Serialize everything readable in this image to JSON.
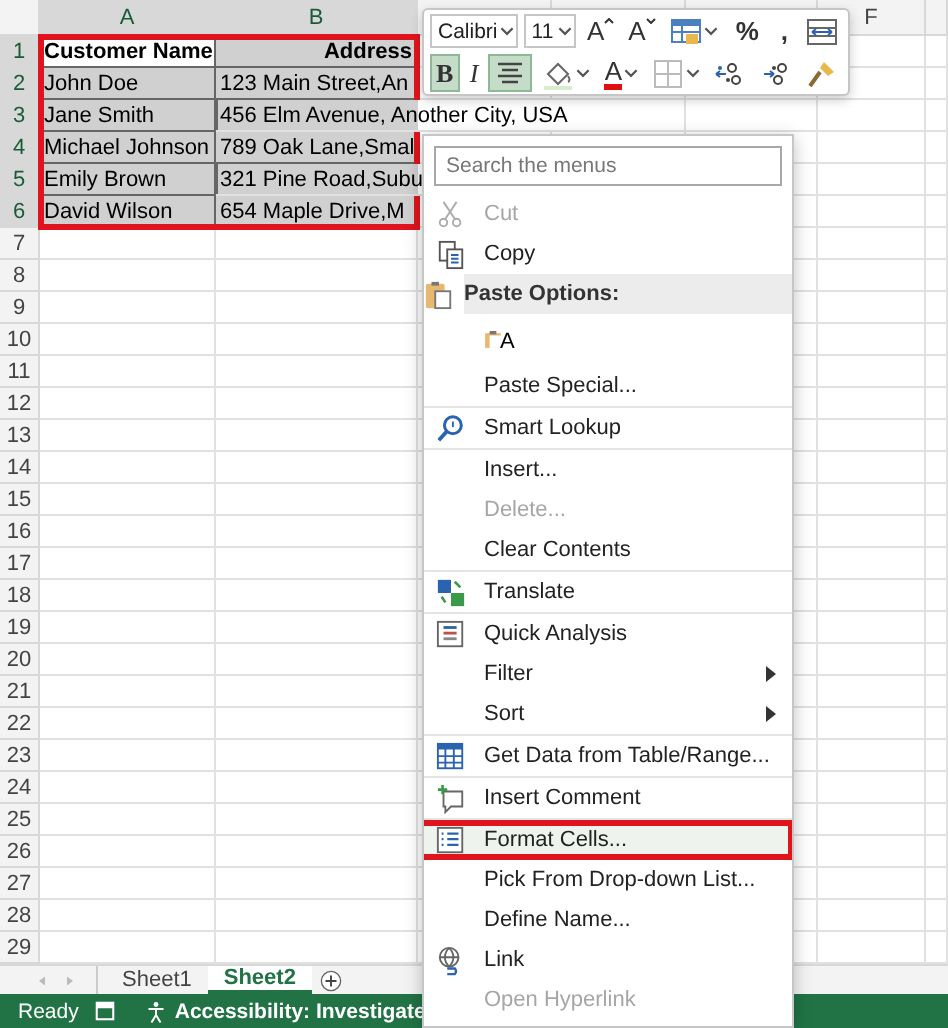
{
  "sheet": {
    "columns": [
      {
        "label": "A",
        "selected": true
      },
      {
        "label": "B",
        "selected": true
      },
      {
        "selected": false
      },
      {
        "selected": false
      },
      {
        "selected": false
      },
      {
        "label": "F",
        "selected": false
      }
    ],
    "row_numbers": [
      {
        "label": "1",
        "selected": true
      },
      {
        "label": "2",
        "selected": true
      },
      {
        "label": "3",
        "selected": true
      },
      {
        "label": "4",
        "selected": true
      },
      {
        "label": "5",
        "selected": true
      },
      {
        "label": "6",
        "selected": true
      },
      {
        "label": "7",
        "selected": false
      },
      {
        "label": "8",
        "selected": false
      },
      {
        "label": "9",
        "selected": false
      },
      {
        "label": "10",
        "selected": false
      },
      {
        "label": "11",
        "selected": false
      },
      {
        "label": "12",
        "selected": false
      },
      {
        "label": "13",
        "selected": false
      },
      {
        "label": "14",
        "selected": false
      },
      {
        "label": "15",
        "selected": false
      },
      {
        "label": "16",
        "selected": false
      },
      {
        "label": "17",
        "selected": false
      },
      {
        "label": "18",
        "selected": false
      },
      {
        "label": "19",
        "selected": false
      },
      {
        "label": "20",
        "selected": false
      },
      {
        "label": "21",
        "selected": false
      },
      {
        "label": "22",
        "selected": false
      },
      {
        "label": "23",
        "selected": false
      },
      {
        "label": "24",
        "selected": false
      },
      {
        "label": "25",
        "selected": false
      },
      {
        "label": "26",
        "selected": false
      },
      {
        "label": "27",
        "selected": false
      },
      {
        "label": "28",
        "selected": false
      },
      {
        "label": "29",
        "selected": false
      }
    ],
    "header": [
      {
        "text": "Customer Name",
        "selected": false
      },
      {
        "text": "Address",
        "selected": true
      }
    ],
    "rows": [
      [
        {
          "text": "John Doe",
          "selected": true
        },
        {
          "text": "123 Main Street,An",
          "selected": true
        }
      ],
      [
        {
          "text": "Jane Smith",
          "selected": true
        },
        {
          "text": "456 Elm Avenue, Another City, USA",
          "selected": true
        }
      ],
      [
        {
          "text": "Michael Johnson",
          "selected": true
        },
        {
          "text": "789 Oak Lane,Smal",
          "selected": true
        }
      ],
      [
        {
          "text": "Emily Brown",
          "selected": true
        },
        {
          "text": "321 Pine Road,Subu",
          "selected": true
        }
      ],
      [
        {
          "text": "David Wilson",
          "selected": true
        },
        {
          "text": "654 Maple Drive,M",
          "selected": true
        }
      ]
    ],
    "range_outlined": true
  },
  "mini_toolbar": {
    "font": "Calibri",
    "size": "11",
    "grow_font": "A",
    "shrink_font": "A",
    "percent": "%",
    "comma": ",",
    "bold": {
      "label": "B",
      "selected": true
    },
    "italic": {
      "label": "I",
      "selected": false
    },
    "center_align": {
      "selected": true
    },
    "font_color": "A"
  },
  "context_menu": {
    "search": {
      "placeholder": "Search the menus"
    },
    "groups": [
      [
        {
          "kind": "command",
          "label": "Cut",
          "disabled": true,
          "submenu": false,
          "outlined": false
        },
        {
          "kind": "command",
          "label": "Copy",
          "disabled": false,
          "submenu": false,
          "outlined": false
        },
        {
          "kind": "header",
          "label": "Paste Options:"
        },
        {
          "kind": "paste_option",
          "label": "A"
        },
        {
          "kind": "command",
          "label": "Paste Special...",
          "disabled": false,
          "submenu": false,
          "outlined": false
        }
      ],
      [
        {
          "kind": "command",
          "label": "Smart Lookup",
          "disabled": false,
          "submenu": false,
          "outlined": false
        }
      ],
      [
        {
          "kind": "command",
          "label": "Insert...",
          "disabled": false,
          "submenu": false,
          "outlined": false
        },
        {
          "kind": "command",
          "label": "Delete...",
          "disabled": true,
          "submenu": false,
          "outlined": false
        },
        {
          "kind": "command",
          "label": "Clear Contents",
          "disabled": false,
          "submenu": false,
          "outlined": false
        }
      ],
      [
        {
          "kind": "command",
          "label": "Translate",
          "disabled": false,
          "submenu": false,
          "outlined": false
        }
      ],
      [
        {
          "kind": "command",
          "label": "Quick Analysis",
          "disabled": false,
          "submenu": false,
          "outlined": false
        },
        {
          "kind": "command",
          "label": "Filter",
          "disabled": false,
          "submenu": true,
          "outlined": false
        },
        {
          "kind": "command",
          "label": "Sort",
          "disabled": false,
          "submenu": true,
          "outlined": false
        }
      ],
      [
        {
          "kind": "command",
          "label": "Get Data from Table/Range...",
          "disabled": false,
          "submenu": false,
          "outlined": false
        }
      ],
      [
        {
          "kind": "command",
          "label": "Insert Comment",
          "disabled": false,
          "submenu": false,
          "outlined": false
        }
      ],
      [
        {
          "kind": "command",
          "label": "Format Cells...",
          "disabled": false,
          "submenu": false,
          "outlined": true
        },
        {
          "kind": "command",
          "label": "Pick From Drop-down List...",
          "disabled": false,
          "submenu": false,
          "outlined": false
        },
        {
          "kind": "command",
          "label": "Define Name...",
          "disabled": false,
          "submenu": false,
          "outlined": false
        },
        {
          "kind": "command",
          "label": "Link",
          "disabled": false,
          "submenu": false,
          "outlined": false
        },
        {
          "kind": "command",
          "label": "Open Hyperlink",
          "disabled": true,
          "submenu": false,
          "outlined": false
        }
      ]
    ]
  },
  "sheet_tabs": [
    {
      "label": "Sheet1",
      "selected": false
    },
    {
      "label": "Sheet2",
      "selected": true
    }
  ],
  "status_bar": {
    "ready": "Ready",
    "accessibility": "Accessibility: Investigate"
  }
}
